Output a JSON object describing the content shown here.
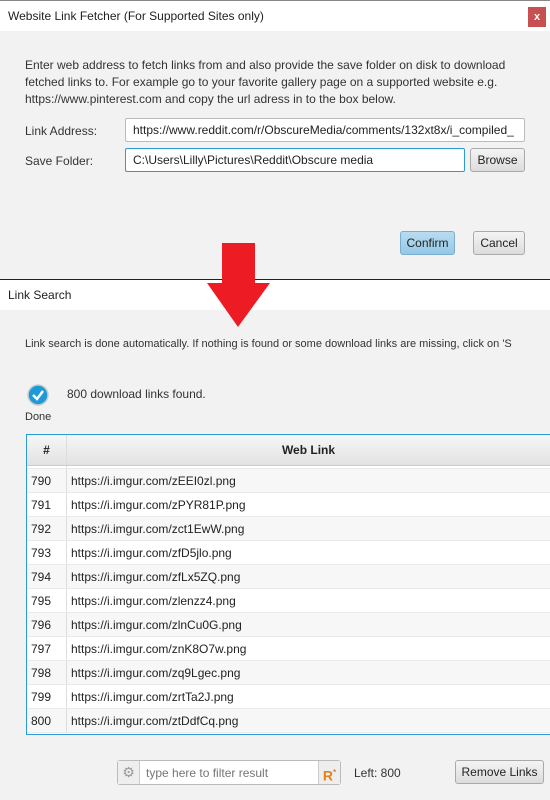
{
  "dialog1": {
    "title": "Website Link Fetcher (For Supported Sites only)",
    "close_label": "x",
    "description": "Enter web address to fetch links from and also provide the save folder on disk to download fetched links to. For example go to your favorite gallery page on a supported website e.g. https://www.pinterest.com and copy the url adress in to the box below.",
    "link_label": "Link Address:",
    "link_value": "https://www.reddit.com/r/ObscureMedia/comments/132xt8x/i_compiled_",
    "folder_label": "Save Folder:",
    "folder_value": "C:\\Users\\Lilly\\Pictures\\Reddit\\Obscure media",
    "browse": "Browse",
    "confirm": "Confirm",
    "cancel": "Cancel"
  },
  "annotation": {
    "arrow_color": "#ed1c24"
  },
  "dialog2": {
    "title": "Link Search",
    "info": "Link search is done automatically. If nothing is found or some download links are missing, click on 'S",
    "status_label": "Done",
    "status_text": "800 download links found.",
    "table": {
      "headers": [
        "#",
        "Web Link"
      ],
      "rows": [
        [
          "790",
          "https://i.imgur.com/zEEI0zl.png"
        ],
        [
          "791",
          "https://i.imgur.com/zPYR81P.png"
        ],
        [
          "792",
          "https://i.imgur.com/zct1EwW.png"
        ],
        [
          "793",
          "https://i.imgur.com/zfD5jlo.png"
        ],
        [
          "794",
          "https://i.imgur.com/zfLx5ZQ.png"
        ],
        [
          "795",
          "https://i.imgur.com/zlenzz4.png"
        ],
        [
          "796",
          "https://i.imgur.com/zlnCu0G.png"
        ],
        [
          "797",
          "https://i.imgur.com/znK8O7w.png"
        ],
        [
          "798",
          "https://i.imgur.com/zq9Lgec.png"
        ],
        [
          "799",
          "https://i.imgur.com/zrtTa2J.png"
        ],
        [
          "800",
          "https://i.imgur.com/ztDdfCq.png"
        ]
      ]
    },
    "filter_placeholder": "type here to filter result",
    "left_text": "Left: 800",
    "remove": "Remove Links"
  }
}
